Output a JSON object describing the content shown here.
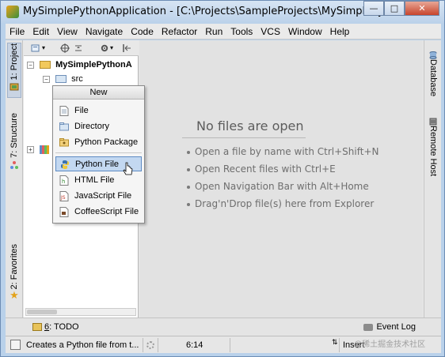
{
  "window": {
    "title": "MySimplePythonApplication - [C:\\Projects\\SampleProjects\\MySimplePythonA..."
  },
  "menubar": [
    "File",
    "Edit",
    "View",
    "Navigate",
    "Code",
    "Refactor",
    "Run",
    "Tools",
    "VCS",
    "Window",
    "Help"
  ],
  "left_stripe": {
    "project_tab": "1: Project",
    "structure_tab": "7: Structure",
    "favorites_tab": "2: Favorites"
  },
  "right_stripe": {
    "database_tab": "Database",
    "remote_host_tab": "Remote Host"
  },
  "project_tree": {
    "root": "MySimplePythonA",
    "child": "src"
  },
  "popup": {
    "title": "New",
    "items": [
      "File",
      "Directory",
      "Python Package",
      "Python File",
      "HTML File",
      "JavaScript File",
      "CoffeeScript File"
    ],
    "selected": "Python File"
  },
  "editor": {
    "empty_title": "No files are open",
    "hints": [
      "Open a file by name with Ctrl+Shift+N",
      "Open Recent files with Ctrl+E",
      "Open Navigation Bar with Alt+Home",
      "Drag'n'Drop file(s) here from Explorer"
    ]
  },
  "bottom_stripe": {
    "todo_num": "6",
    "todo_label": ": TODO",
    "event_log": "Event Log"
  },
  "statusbar": {
    "message": "Creates a Python file from t...",
    "position": "6:14",
    "insert_mode": "Insert",
    "watermark": "@稀土掘金技术社区"
  },
  "colors": {
    "selection_bg": "#c3d8f1",
    "selection_border": "#5d8bc3",
    "close_button": "#c8452c"
  }
}
